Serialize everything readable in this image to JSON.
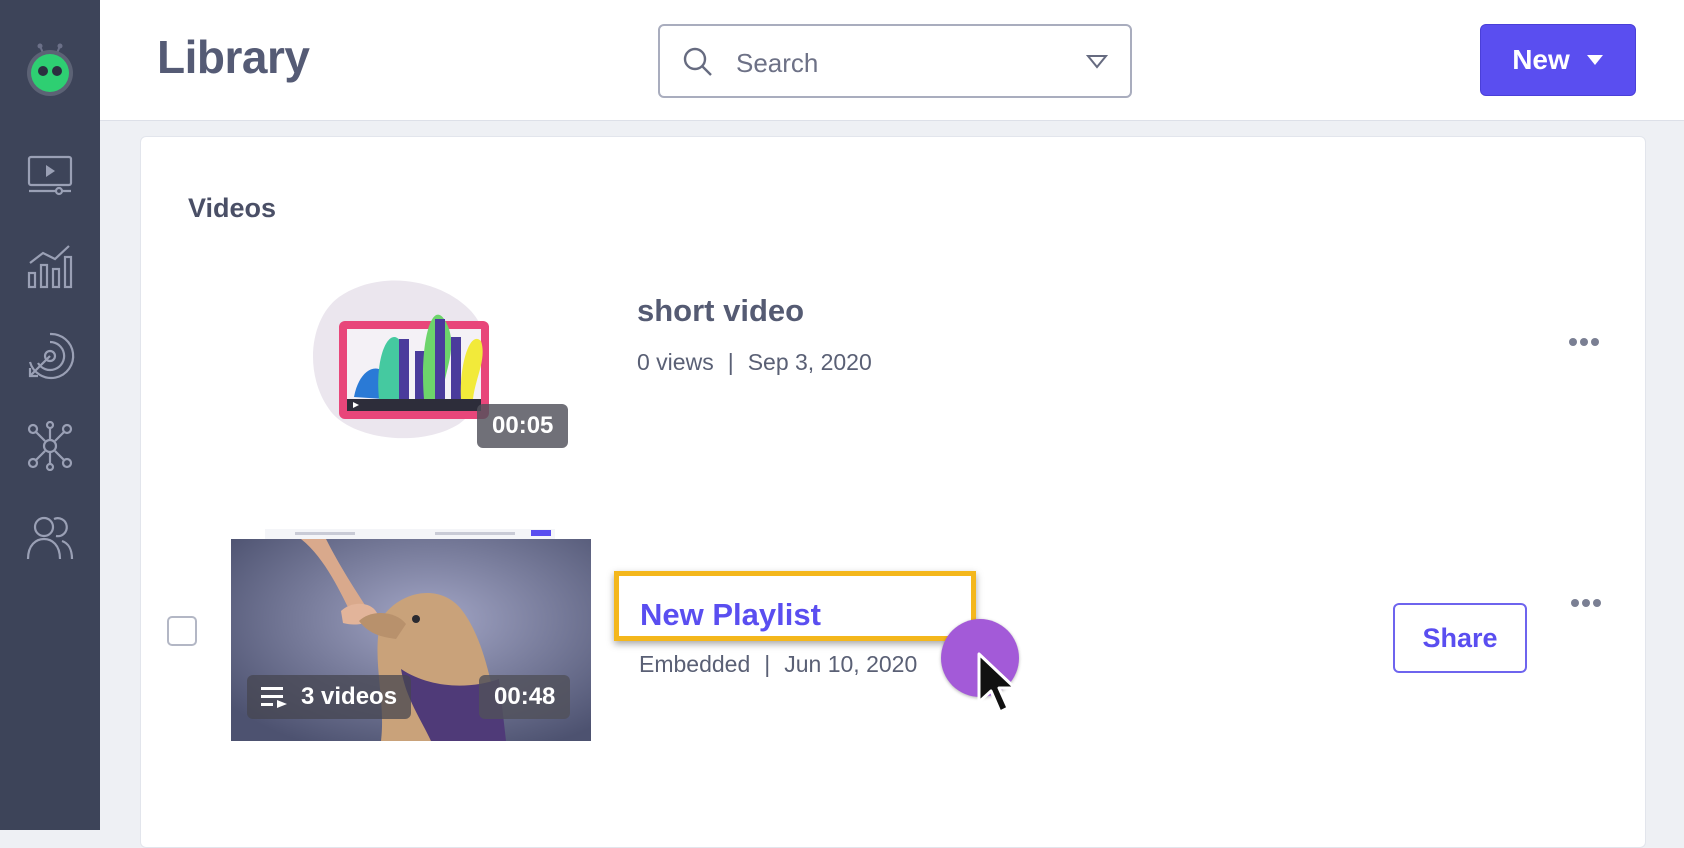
{
  "header": {
    "title": "Library",
    "search_placeholder": "Search",
    "new_button_label": "New"
  },
  "sidebar": {
    "items": [
      {
        "icon": "app-logo-icon"
      },
      {
        "icon": "video-player-icon"
      },
      {
        "icon": "analytics-chart-icon"
      },
      {
        "icon": "target-icon"
      },
      {
        "icon": "integrations-network-icon"
      },
      {
        "icon": "users-icon"
      }
    ]
  },
  "main": {
    "section_heading": "Videos",
    "items": [
      {
        "title": "short video",
        "views": "0 views",
        "date": "Sep 3, 2020",
        "duration": "00:05"
      },
      {
        "title": "New Playlist",
        "type": "Embedded",
        "date": "Jun 10, 2020",
        "video_count": "3 videos",
        "duration": "00:48",
        "share_label": "Share"
      }
    ]
  },
  "colors": {
    "accent": "#5a4ef0",
    "sidebar_bg": "#3d4459",
    "highlight": "#f4b71c",
    "click_indicator": "#a35ad8"
  }
}
